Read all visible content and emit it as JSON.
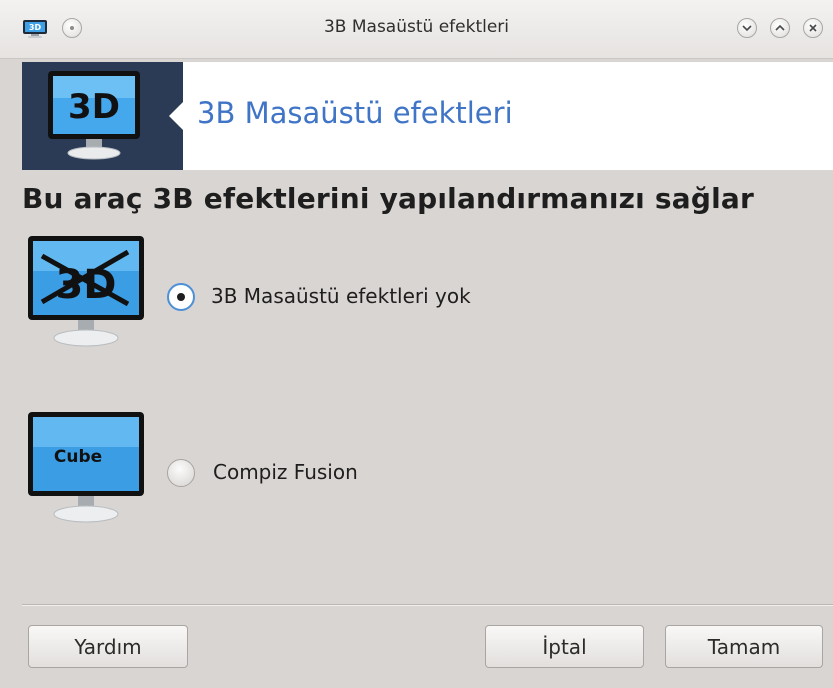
{
  "window": {
    "title": "3B Masaüstü efektleri",
    "app_icon_label": "3D"
  },
  "banner": {
    "title": "3B Masaüstü efektleri",
    "icon_label": "3D"
  },
  "main": {
    "heading": "Bu araç 3B efektlerini yapılandırmanızı sağlar",
    "options": [
      {
        "label": "3B Masaüstü efektleri yok",
        "icon_text": "3D",
        "selected": true
      },
      {
        "label": "Compiz Fusion",
        "icon_text": "Cube",
        "selected": false
      }
    ]
  },
  "buttons": {
    "help": "Yardım",
    "cancel": "İptal",
    "ok": "Tamam"
  },
  "colors": {
    "banner_dark": "#2b3a55",
    "banner_title": "#3f74c6",
    "radio_focus": "#4d90d6",
    "background": "#d9d5d2"
  }
}
